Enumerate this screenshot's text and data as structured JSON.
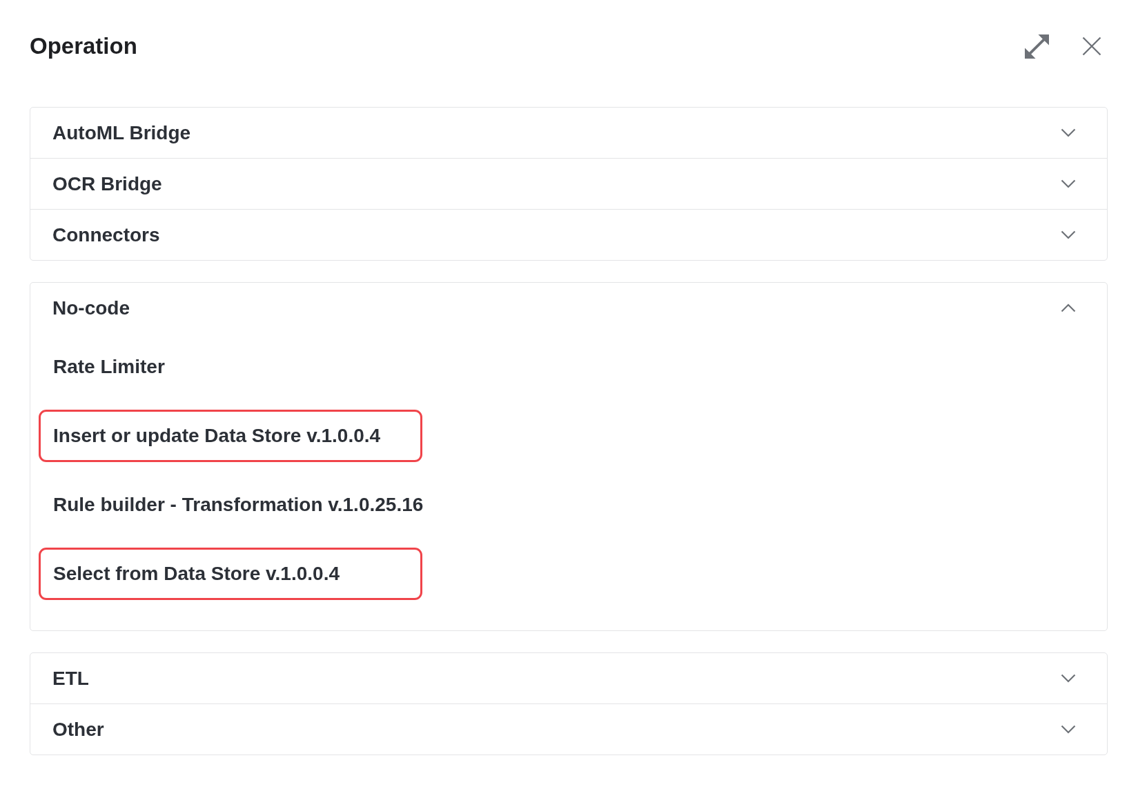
{
  "header": {
    "title": "Operation"
  },
  "sections": [
    {
      "label": "AutoML Bridge",
      "expanded": false
    },
    {
      "label": "OCR Bridge",
      "expanded": false
    },
    {
      "label": "Connectors",
      "expanded": false
    },
    {
      "label": "No-code",
      "expanded": true,
      "items": [
        {
          "label": "Rate Limiter",
          "highlighted": false
        },
        {
          "label": "Insert or update Data Store v.1.0.0.4",
          "highlighted": true
        },
        {
          "label": "Rule builder - Transformation v.1.0.25.16",
          "highlighted": false
        },
        {
          "label": "Select from Data Store v.1.0.0.4",
          "highlighted": true
        }
      ]
    },
    {
      "label": "ETL",
      "expanded": false
    },
    {
      "label": "Other",
      "expanded": false
    }
  ]
}
